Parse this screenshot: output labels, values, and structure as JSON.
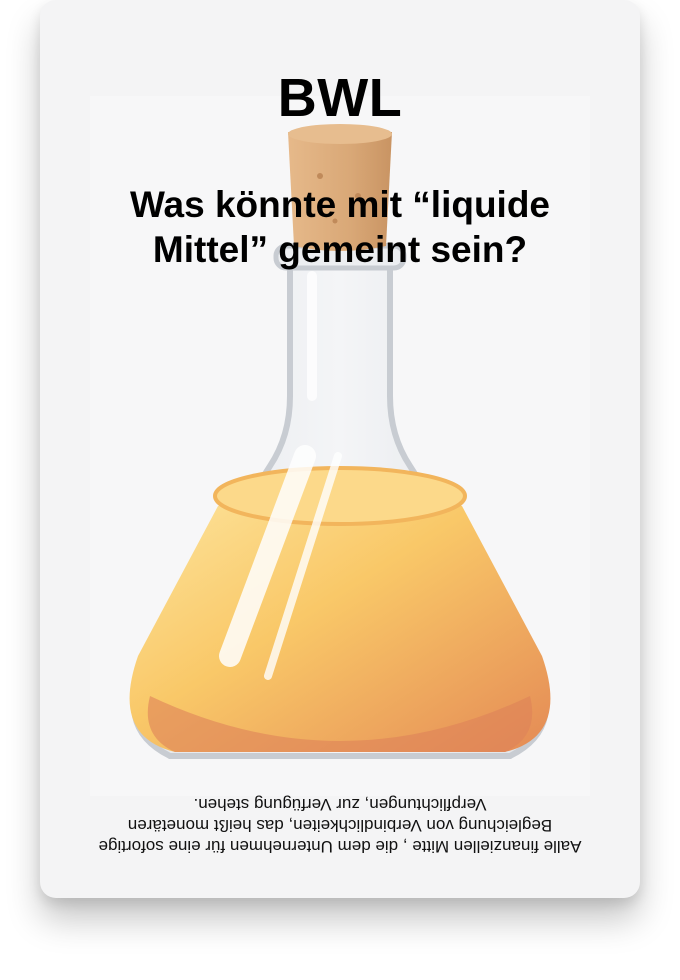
{
  "card": {
    "category": "BWL",
    "question": "Was könnte mit “liquide Mittel” gemeint sein?",
    "answer": "Aalle finanziellen Mitte , die dem Unternehmen für eine sofortige Begleichung von Verbindlichkeiten, das heißt monetären Verpflichtungen, zur Verfügung stehen.",
    "illustration_icon": "flask-with-liquid-icon"
  },
  "colors": {
    "card_background": "#f4f4f5",
    "text": "#000000",
    "cork": "#d9a877",
    "liquid_light": "#fbd37a",
    "liquid_dark": "#e69a52",
    "liquid_edge": "#d8745a"
  }
}
